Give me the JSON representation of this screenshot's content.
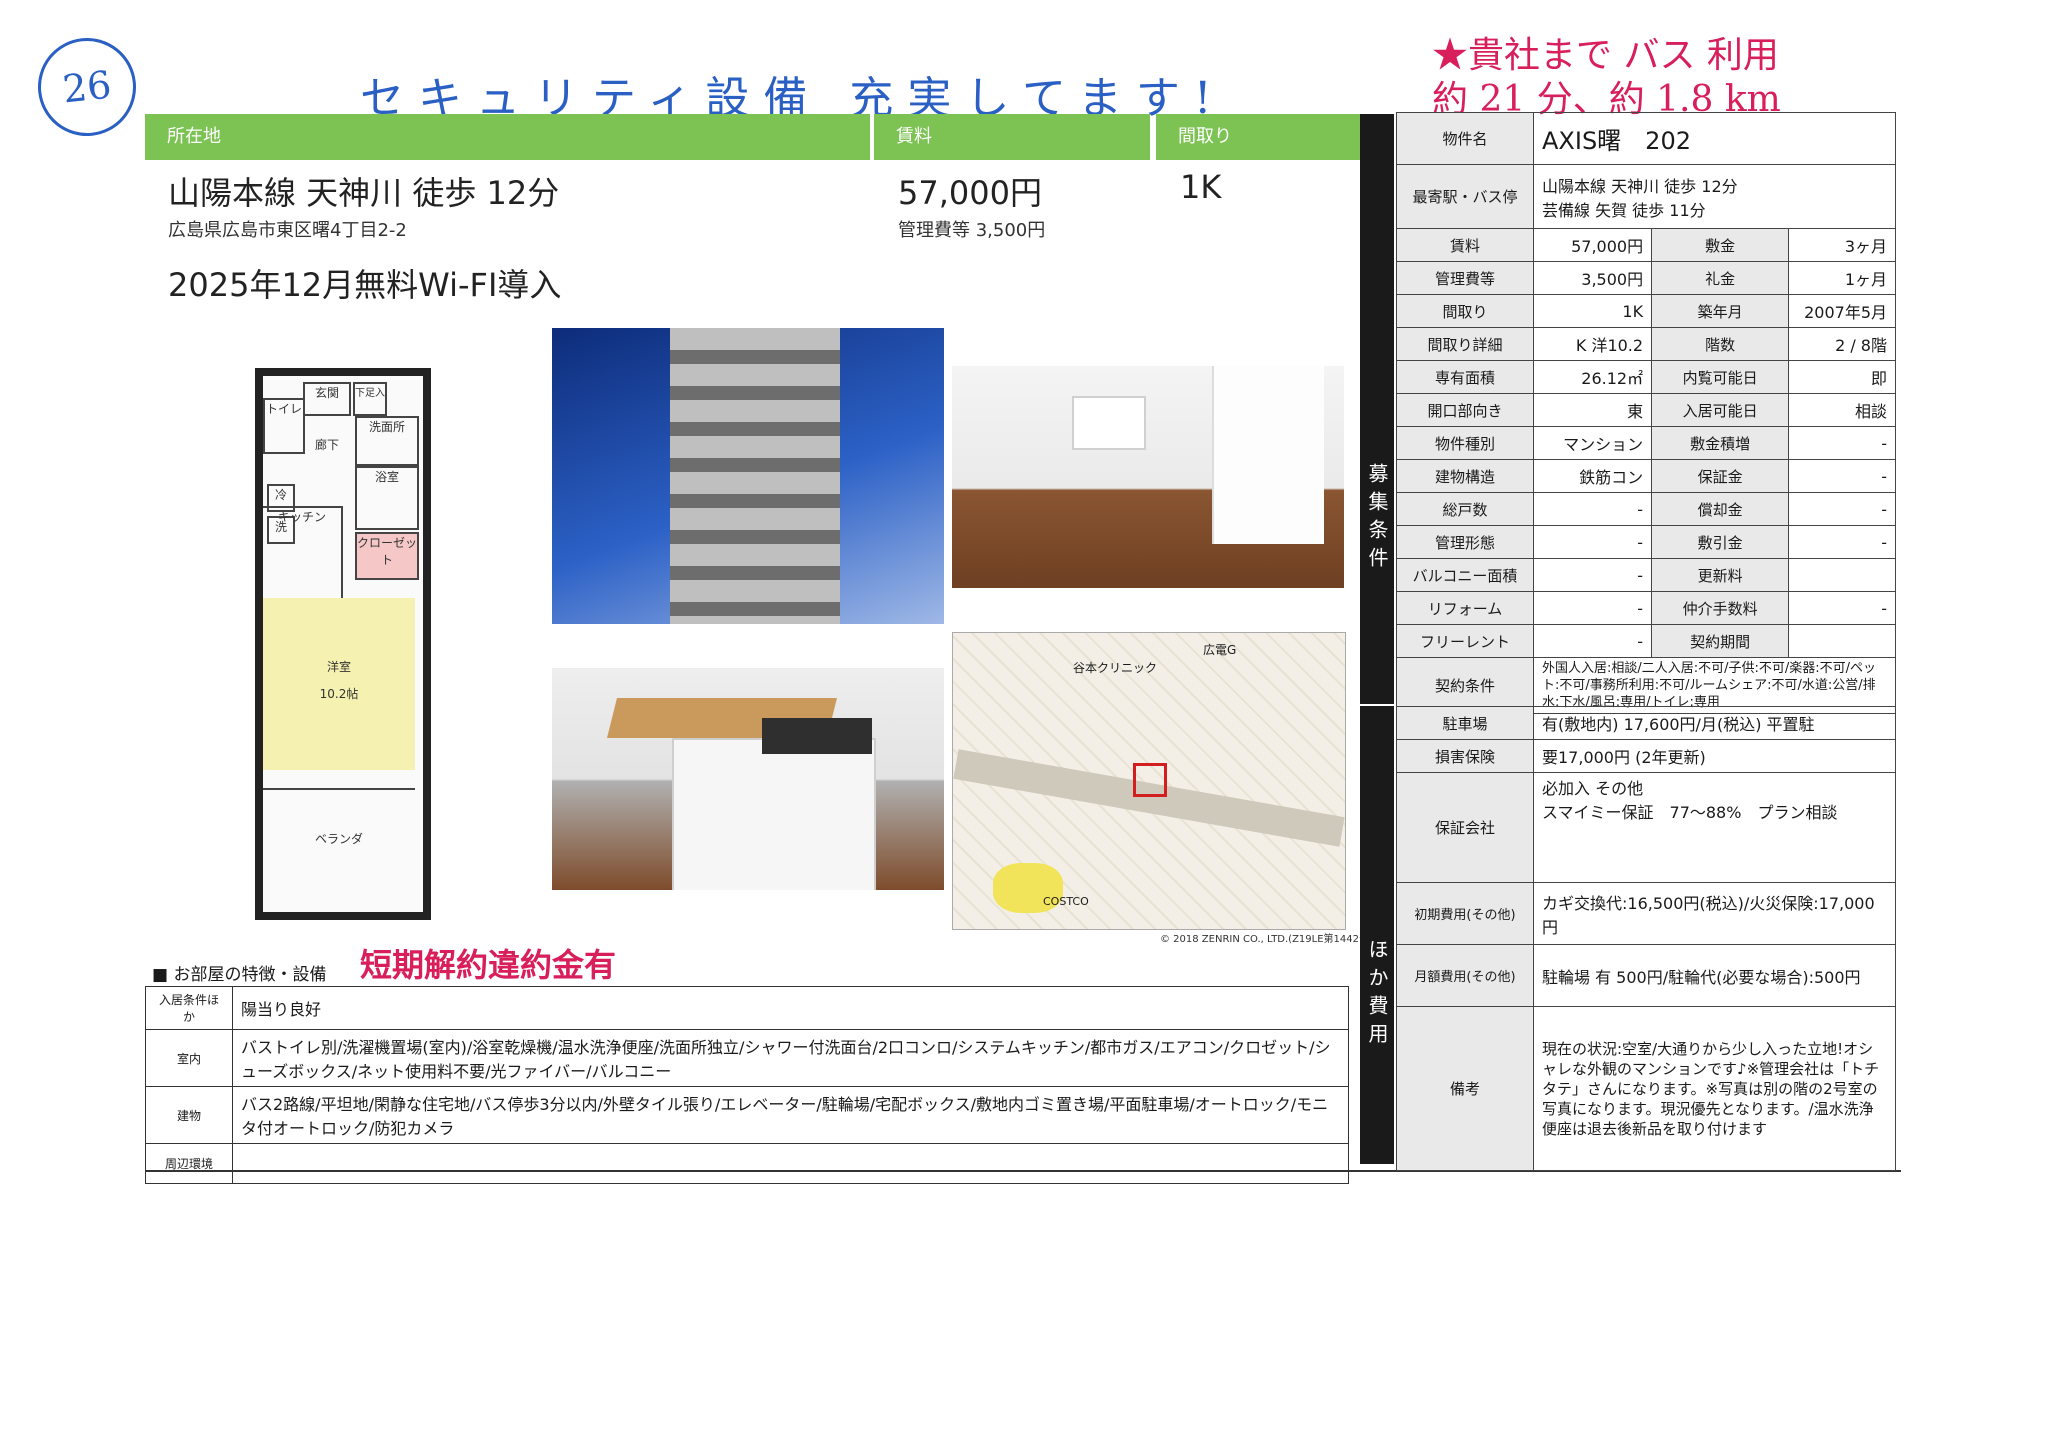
{
  "annotations": {
    "page_number": "26",
    "handwritten_top": "セキュリティ設備 充実してます!",
    "handwritten_right_line1": "★貴社まで バス 利用",
    "handwritten_right_line2": "約 21 分、約 1.8 km",
    "handwritten_penalty": "短期解約違約金有"
  },
  "header": {
    "location_label": "所在地",
    "rent_label": "賃料",
    "layout_label": "間取り",
    "access": "山陽本線 天神川 徒歩 12分",
    "address": "広島県広島市東区曙4丁目2-2",
    "rent": "57,000円",
    "fee": "管理費等 3,500円",
    "layout": "1K",
    "notice": "2025年12月無料Wi-FI導入"
  },
  "floorplan": {
    "entrance": "玄関",
    "storage": "下足入",
    "toilet": "トイレ",
    "washroom": "洗面所",
    "hallway": "廊下",
    "fridge": "冷",
    "bath": "浴室",
    "washer": "洗",
    "kitchen": "キッチン",
    "closet": "クローゼット",
    "western_room": "洋室",
    "room_size": "10.2帖",
    "balcony": "ベランダ"
  },
  "map": {
    "clinic": "谷本クリニック",
    "station": "広電G",
    "costco": "COSTCO",
    "copyright": "© 2018 ZENRIN CO., LTD.(Z19LE第1442号)"
  },
  "features": {
    "title": "■ お部屋の特徴・設備",
    "rows": [
      {
        "label": "入居条件ほか",
        "value": "陽当り良好"
      },
      {
        "label": "室内",
        "value": "バストイレ別/洗濯機置場(室内)/浴室乾燥機/温水洗浄便座/洗面所独立/シャワー付洗面台/2口コンロ/システムキッチン/都市ガス/エアコン/クロゼット/シューズボックス/ネット使用料不要/光ファイバー/バルコニー"
      },
      {
        "label": "建物",
        "value": "バス2路線/平坦地/閑静な住宅地/バス停歩3分以内/外壁タイル張り/エレベーター/駐輪場/宅配ボックス/敷地内ゴミ置き場/平面駐車場/オートロック/モニタ付オートロック/防犯カメラ"
      },
      {
        "label": "周辺環境",
        "value": ""
      }
    ]
  },
  "spec": {
    "side_label_1": "募集条件",
    "side_label_2": "ほか費用",
    "property_name_label": "物件名",
    "property_name": "AXIS曙　202",
    "station_label": "最寄駅・バス停",
    "station_1": "山陽本線 天神川 徒歩 12分",
    "station_2": "芸備線 矢賀 徒歩 11分",
    "pairs": [
      {
        "l1": "賃料",
        "v1": "57,000円",
        "l2": "敷金",
        "v2": "3ヶ月"
      },
      {
        "l1": "管理費等",
        "v1": "3,500円",
        "l2": "礼金",
        "v2": "1ヶ月"
      },
      {
        "l1": "間取り",
        "v1": "1K",
        "l2": "築年月",
        "v2": "2007年5月"
      },
      {
        "l1": "間取り詳細",
        "v1": "K 洋10.2",
        "l2": "階数",
        "v2": "2 / 8階"
      },
      {
        "l1": "専有面積",
        "v1": "26.12㎡",
        "l2": "内覧可能日",
        "v2": "即"
      },
      {
        "l1": "開口部向き",
        "v1": "東",
        "l2": "入居可能日",
        "v2": "相談"
      },
      {
        "l1": "物件種別",
        "v1": "マンション",
        "l2": "敷金積増",
        "v2": "-"
      },
      {
        "l1": "建物構造",
        "v1": "鉄筋コン",
        "l2": "保証金",
        "v2": "-"
      },
      {
        "l1": "総戸数",
        "v1": "-",
        "l2": "償却金",
        "v2": "-"
      },
      {
        "l1": "管理形態",
        "v1": "-",
        "l2": "敷引金",
        "v2": "-"
      },
      {
        "l1": "バルコニー面積",
        "v1": "-",
        "l2": "更新料",
        "v2": ""
      },
      {
        "l1": "リフォーム",
        "v1": "-",
        "l2": "仲介手数料",
        "v2": "-"
      },
      {
        "l1": "フリーレント",
        "v1": "-",
        "l2": "契約期間",
        "v2": ""
      }
    ],
    "contract_label": "契約条件",
    "contract": "外国人入居:相談/二人入居:不可/子供:不可/楽器:不可/ペット:不可/事務所利用:不可/ルームシェア:不可/水道:公営/排水:下水/風呂:専用/トイレ:専用",
    "parking_label": "駐車場",
    "parking": "有(敷地内) 17,600円/月(税込) 平置駐",
    "insurance_label": "損害保険",
    "insurance": "要17,000円 (2年更新)",
    "guarantor_label": "保証会社",
    "guarantor_1": "必加入 その他",
    "guarantor_2": "スマイミー保証　77〜88%　プラン相談",
    "initial_label": "初期費用(その他)",
    "initial": "カギ交換代:16,500円(税込)/火災保険:17,000円",
    "monthly_label": "月額費用(その他)",
    "monthly": "駐輪場 有 500円/駐輪代(必要な場合):500円",
    "remarks_label": "備考",
    "remarks": "現在の状況:空室/大通りから少し入った立地!オシャレな外観のマンションです♪※管理会社は「トチタテ」さんになります。※写真は別の階の2号室の写真になります。現況優先となります。/温水洗浄便座は退去後新品を取り付けます"
  }
}
